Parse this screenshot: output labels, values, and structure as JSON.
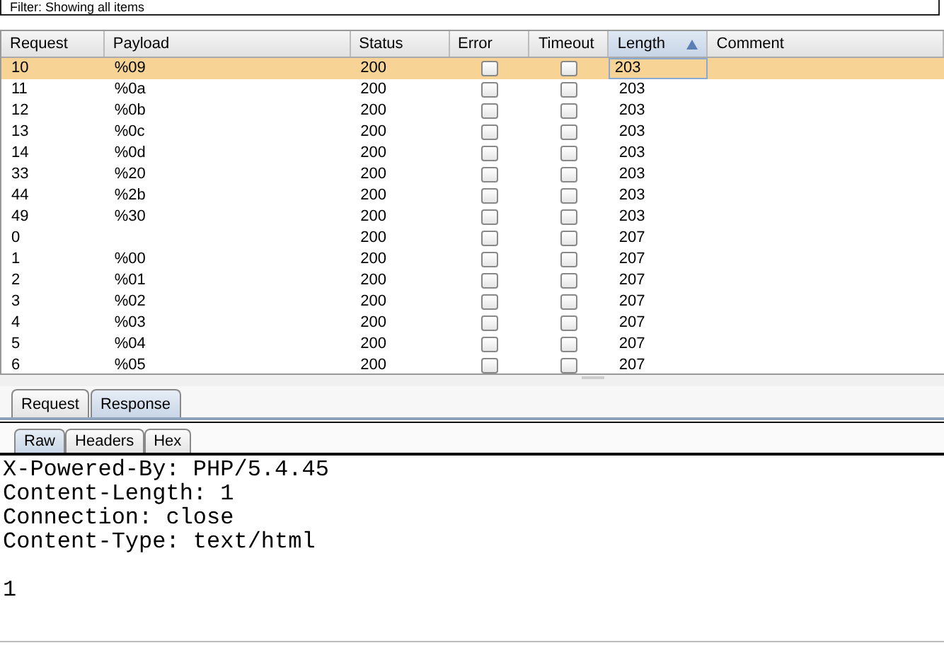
{
  "filter": {
    "text": "Filter: Showing all items"
  },
  "table": {
    "columns": [
      {
        "label": "Request",
        "sorted": false
      },
      {
        "label": "Payload",
        "sorted": false
      },
      {
        "label": "Status",
        "sorted": false
      },
      {
        "label": "Error",
        "sorted": false
      },
      {
        "label": "Timeout",
        "sorted": false
      },
      {
        "label": "Length",
        "sorted": true
      },
      {
        "label": "Comment",
        "sorted": false
      }
    ],
    "rows": [
      {
        "request": "10",
        "payload": "%09",
        "status": "200",
        "error": false,
        "timeout": false,
        "length": "203",
        "selected": true
      },
      {
        "request": "11",
        "payload": "%0a",
        "status": "200",
        "error": false,
        "timeout": false,
        "length": "203",
        "selected": false
      },
      {
        "request": "12",
        "payload": "%0b",
        "status": "200",
        "error": false,
        "timeout": false,
        "length": "203",
        "selected": false
      },
      {
        "request": "13",
        "payload": "%0c",
        "status": "200",
        "error": false,
        "timeout": false,
        "length": "203",
        "selected": false
      },
      {
        "request": "14",
        "payload": "%0d",
        "status": "200",
        "error": false,
        "timeout": false,
        "length": "203",
        "selected": false
      },
      {
        "request": "33",
        "payload": "%20",
        "status": "200",
        "error": false,
        "timeout": false,
        "length": "203",
        "selected": false
      },
      {
        "request": "44",
        "payload": "%2b",
        "status": "200",
        "error": false,
        "timeout": false,
        "length": "203",
        "selected": false
      },
      {
        "request": "49",
        "payload": "%30",
        "status": "200",
        "error": false,
        "timeout": false,
        "length": "203",
        "selected": false
      },
      {
        "request": "0",
        "payload": "",
        "status": "200",
        "error": false,
        "timeout": false,
        "length": "207",
        "selected": false
      },
      {
        "request": "1",
        "payload": "%00",
        "status": "200",
        "error": false,
        "timeout": false,
        "length": "207",
        "selected": false
      },
      {
        "request": "2",
        "payload": "%01",
        "status": "200",
        "error": false,
        "timeout": false,
        "length": "207",
        "selected": false
      },
      {
        "request": "3",
        "payload": "%02",
        "status": "200",
        "error": false,
        "timeout": false,
        "length": "207",
        "selected": false
      },
      {
        "request": "4",
        "payload": "%03",
        "status": "200",
        "error": false,
        "timeout": false,
        "length": "207",
        "selected": false
      },
      {
        "request": "5",
        "payload": "%04",
        "status": "200",
        "error": false,
        "timeout": false,
        "length": "207",
        "selected": false
      },
      {
        "request": "6",
        "payload": "%05",
        "status": "200",
        "error": false,
        "timeout": false,
        "length": "207",
        "selected": false
      }
    ]
  },
  "message_tabs": [
    {
      "label": "Request",
      "selected": false
    },
    {
      "label": "Response",
      "selected": true
    }
  ],
  "view_tabs": [
    {
      "label": "Raw",
      "selected": true
    },
    {
      "label": "Headers",
      "selected": false
    },
    {
      "label": "Hex",
      "selected": false
    }
  ],
  "response": {
    "headers": [
      "X-Powered-By: PHP/5.4.45",
      "Content-Length: 1",
      "Connection: close",
      "Content-Type: text/html"
    ],
    "body": "1"
  }
}
